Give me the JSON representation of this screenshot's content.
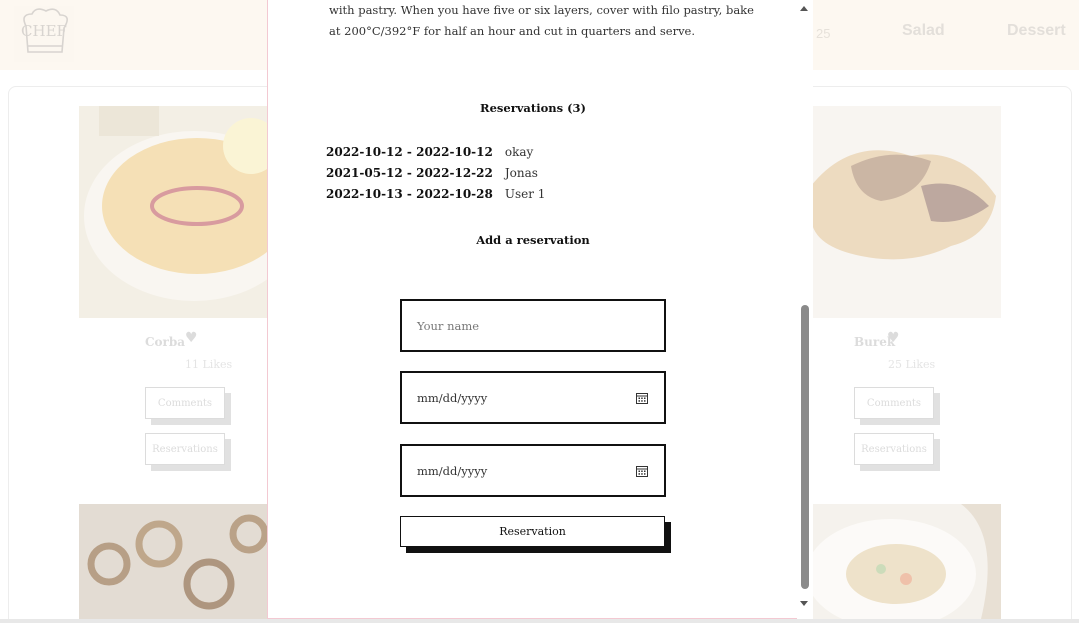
{
  "header": {
    "logo_text": "CHEF",
    "nav_count": "25",
    "nav_items": [
      "Salad",
      "Dessert"
    ]
  },
  "meals": [
    {
      "name": "Corba",
      "likes": "11 Likes",
      "comments_label": "Comments",
      "reservations_label": "Reservations"
    },
    {
      "name": "Burek",
      "likes": "25 Likes",
      "comments_label": "Comments",
      "reservations_label": "Reservations"
    }
  ],
  "modal": {
    "recipe_excerpt": "with pastry. When you have five or six layers, cover with filo pastry, bake at 200°C/392°F for half an hour and cut in quarters and serve.",
    "reservations_heading": "Reservations (3)",
    "reservations": [
      {
        "dates": "2022-10-12 - 2022-10-12",
        "name": "okay"
      },
      {
        "dates": "2021-05-12 - 2022-12-22",
        "name": "Jonas"
      },
      {
        "dates": "2022-10-13 - 2022-10-28",
        "name": "User 1"
      }
    ],
    "add_heading": "Add a reservation",
    "name_placeholder": "Your name",
    "start_date_placeholder": "mm/dd/yyyy",
    "end_date_placeholder": "mm/dd/yyyy",
    "submit_label": "Reservation"
  },
  "colors": {
    "accent": "#111111",
    "header_bg": "#fdf6ec",
    "modal_border": "#f3c9d2",
    "scroll_thumb": "#8a8a8a"
  }
}
